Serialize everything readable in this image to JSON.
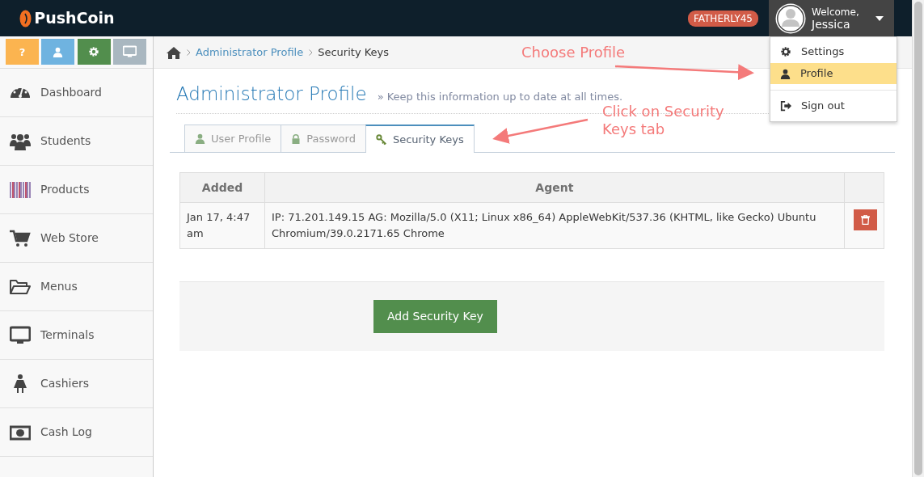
{
  "navbar": {
    "logo": "PushCoin",
    "badge": "FATHERLY45",
    "welcome": "Welcome,",
    "user": "Jessica"
  },
  "user_menu": {
    "items": [
      {
        "label": "Settings",
        "selected": false
      },
      {
        "label": "Profile",
        "selected": true
      },
      {
        "label": "Sign out",
        "selected": false
      }
    ]
  },
  "sidebar": {
    "quick_buttons": [
      {
        "text": "?",
        "color": "#fbb450"
      },
      {
        "color": "#6fb3e0"
      },
      {
        "color": "#528e4d"
      },
      {
        "color": "#a9b7c0"
      }
    ],
    "items": [
      {
        "label": "Dashboard"
      },
      {
        "label": "Students"
      },
      {
        "label": "Products"
      },
      {
        "label": "Web Store"
      },
      {
        "label": "Menus"
      },
      {
        "label": "Terminals"
      },
      {
        "label": "Cashiers"
      },
      {
        "label": "Cash Log"
      }
    ]
  },
  "breadcrumb": [
    "Administrator Profile",
    "Security Keys"
  ],
  "page": {
    "title": "Administrator Profile",
    "subtitle": "» Keep this information up to date at all times."
  },
  "tabs": [
    {
      "label": "User Profile",
      "selected": false
    },
    {
      "label": "Password",
      "selected": false
    },
    {
      "label": "Security Keys",
      "selected": true
    }
  ],
  "table": {
    "columns": [
      "Added",
      "Agent"
    ],
    "rows": [
      {
        "added": "Jan 17, 4:47 am",
        "agent": "IP: 71.201.149.15 AG: Mozilla/5.0 (X11; Linux x86_64) AppleWebKit/537.36 (KHTML, like Gecko) Ubuntu Chromium/39.0.2171.65 Chrome"
      }
    ]
  },
  "add_button": "Add Security Key",
  "annotations": [
    {
      "text": "Choose Profile"
    },
    {
      "text": "Click on Security Keys tab"
    }
  ]
}
